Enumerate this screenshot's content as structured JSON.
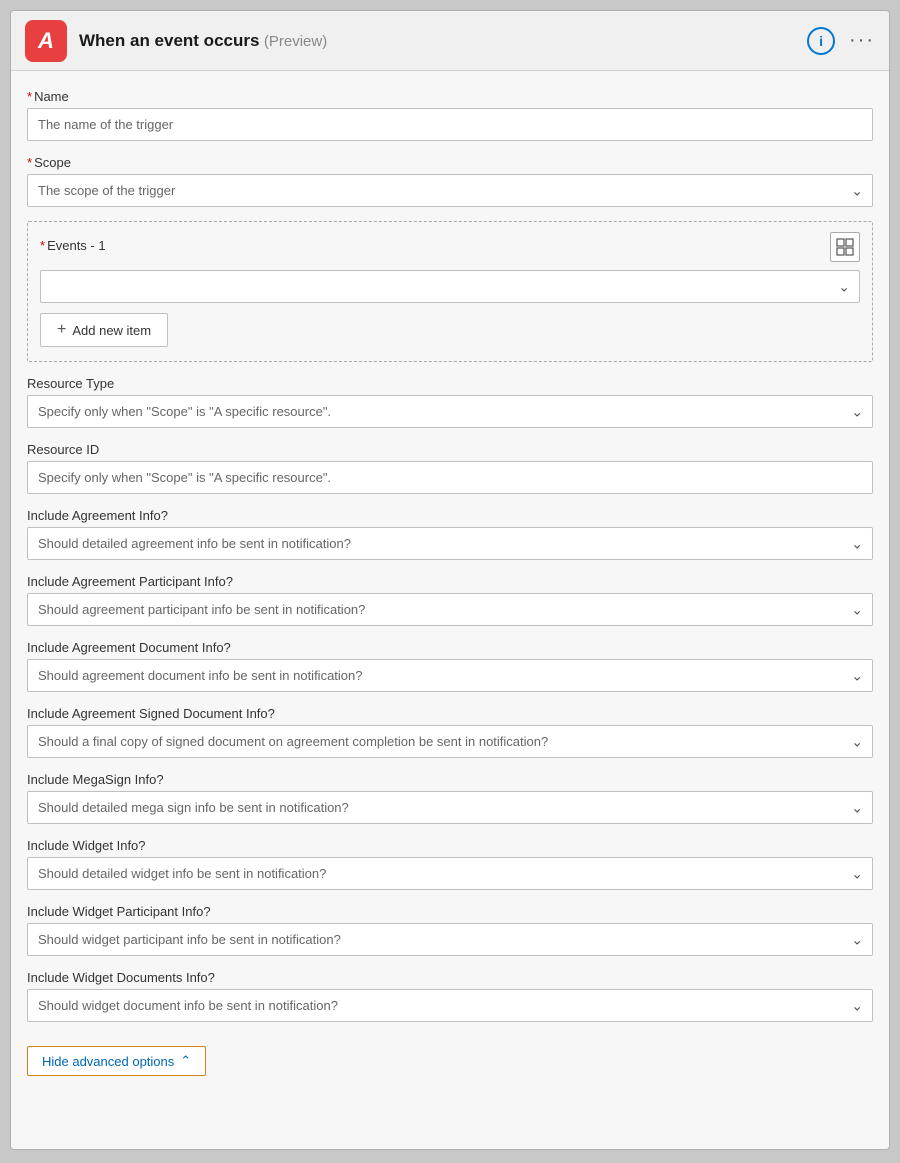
{
  "header": {
    "title": "When an event occurs",
    "preview_label": "(Preview)",
    "info_icon": "info-icon",
    "more_icon": "more-icon"
  },
  "name_field": {
    "label": "Name",
    "required": true,
    "placeholder": "The name of the trigger",
    "value": "The name of the trigger"
  },
  "scope_field": {
    "label": "Scope",
    "required": true,
    "placeholder": "The scope of the trigger",
    "value": "The scope of the trigger"
  },
  "events_section": {
    "label": "Events - 1",
    "required": true,
    "add_item_label": "Add new item"
  },
  "resource_type_field": {
    "label": "Resource Type",
    "placeholder": "Specify only when \"Scope\" is \"A specific resource\".",
    "value": "Specify only when \"Scope\" is \"A specific resource\"."
  },
  "resource_id_field": {
    "label": "Resource ID",
    "placeholder": "Specify only when \"Scope\" is \"A specific resource\".",
    "value": "Specify only when \"Scope\" is \"A specific resource\"."
  },
  "include_agreement_info": {
    "label": "Include Agreement Info?",
    "placeholder": "Should detailed agreement info be sent in notification?",
    "value": "Should detailed agreement info be sent in notification?"
  },
  "include_agreement_participant_info": {
    "label": "Include Agreement Participant Info?",
    "placeholder": "Should agreement participant info be sent in notification?",
    "value": "Should agreement participant info be sent in notification?"
  },
  "include_agreement_document_info": {
    "label": "Include Agreement Document Info?",
    "placeholder": "Should agreement document info be sent in notification?",
    "value": "Should agreement document info be sent in notification?"
  },
  "include_agreement_signed_document_info": {
    "label": "Include Agreement Signed Document Info?",
    "placeholder": "Should a final copy of signed document on agreement completion be sent in notification?",
    "value": "Should a final copy of signed document on agreement completion be sent in notification?"
  },
  "include_megasign_info": {
    "label": "Include MegaSign Info?",
    "placeholder": "Should detailed mega sign info be sent in notification?",
    "value": "Should detailed mega sign info be sent in notification?"
  },
  "include_widget_info": {
    "label": "Include Widget Info?",
    "placeholder": "Should detailed widget info be sent in notification?",
    "value": "Should detailed widget info be sent in notification?"
  },
  "include_widget_participant_info": {
    "label": "Include Widget Participant Info?",
    "placeholder": "Should widget participant info be sent in notification?",
    "value": "Should widget participant info be sent in notification?"
  },
  "include_widget_documents_info": {
    "label": "Include Widget Documents Info?",
    "placeholder": "Should widget document info be sent in notification?",
    "value": "Should widget document info be sent in notification?"
  },
  "hide_advanced_label": "Hide advanced options"
}
